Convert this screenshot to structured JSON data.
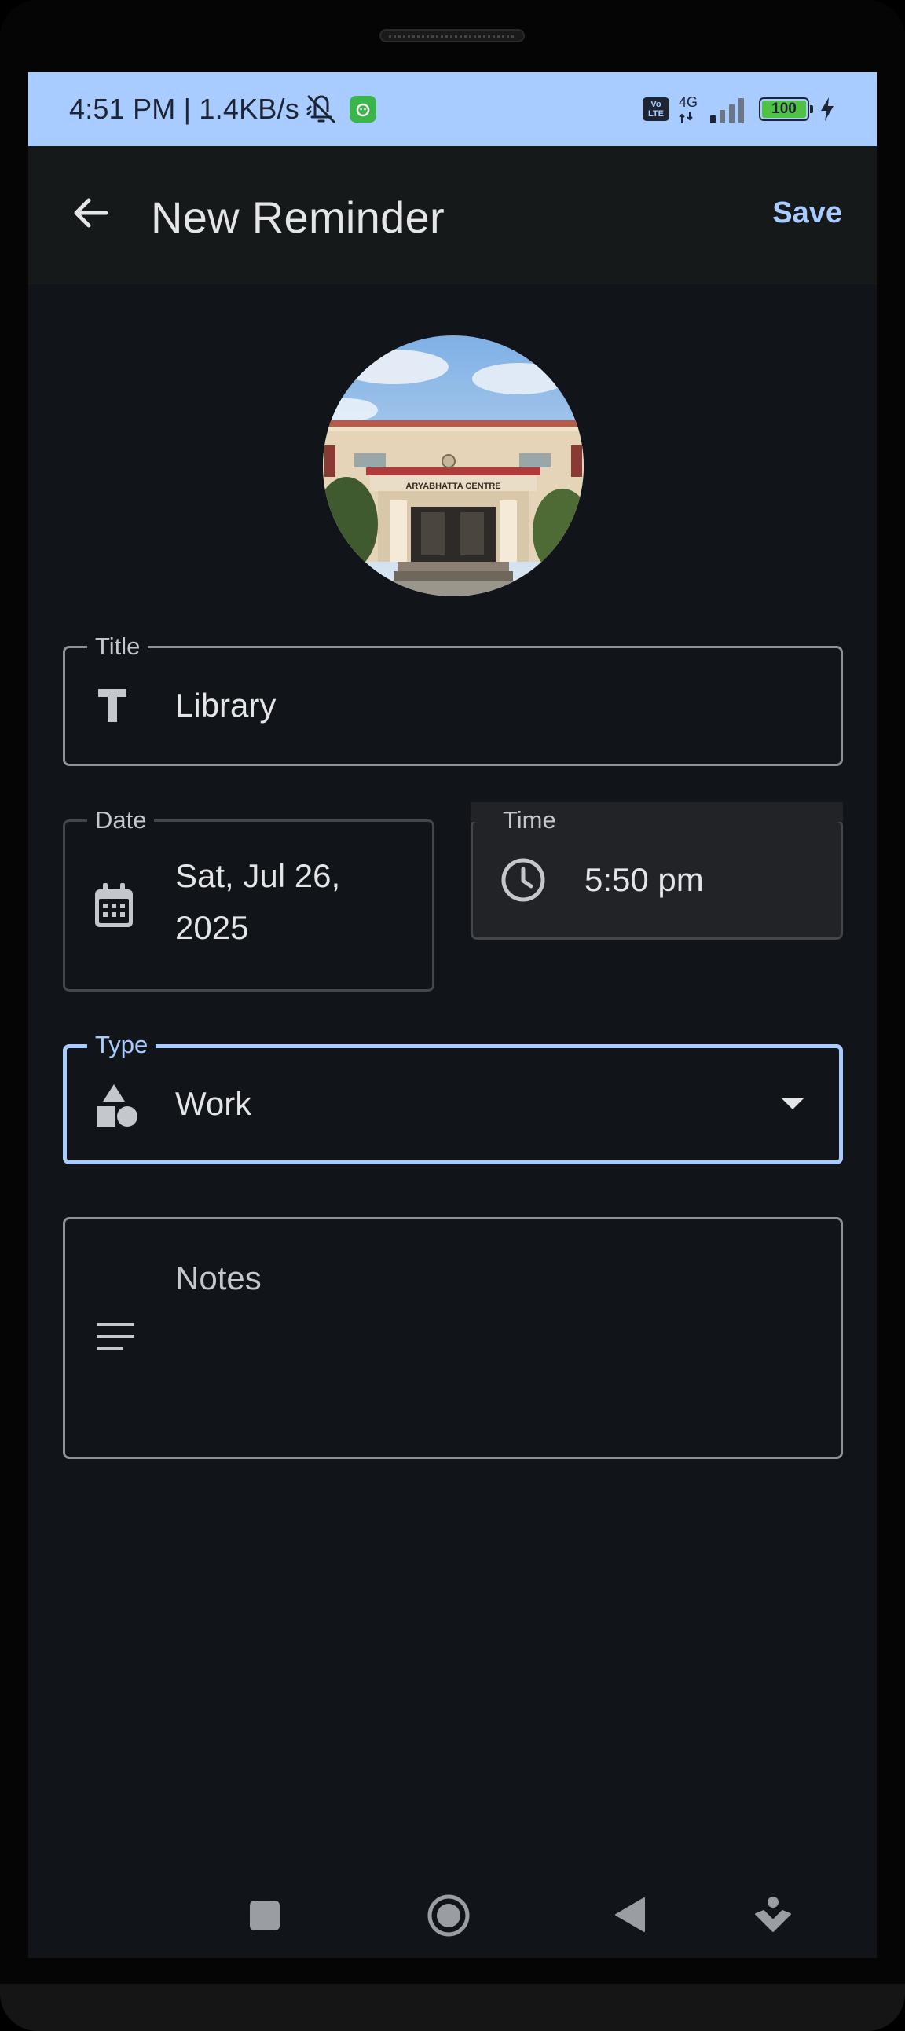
{
  "status_bar": {
    "time": "4:51 PM | 1.4KB/s",
    "volte": "Vo LTE",
    "network": "4G",
    "battery": "100"
  },
  "app_bar": {
    "title": "New Reminder",
    "save_label": "Save"
  },
  "form": {
    "title": {
      "label": "Title",
      "value": "Library"
    },
    "date": {
      "label": "Date",
      "value_line1": "Sat, Jul 26,",
      "value_line2": "2025"
    },
    "time": {
      "label": "Time",
      "value": "5:50 pm"
    },
    "type": {
      "label": "Type",
      "value": "Work"
    },
    "notes": {
      "placeholder": "Notes"
    }
  },
  "avatar": {
    "sign_text": "ARYABHATTA CENTRE"
  },
  "colors": {
    "accent": "#a8ccff",
    "background": "#111418",
    "app_bar": "#15191a",
    "status_bar": "#a8ccff"
  },
  "icons": {
    "back": "arrow-left-icon",
    "title": "text-t-icon",
    "date": "calendar-icon",
    "time": "clock-icon",
    "type": "shapes-icon",
    "type_dropdown": "dropdown-arrow-icon",
    "notes": "notes-lines-icon"
  }
}
